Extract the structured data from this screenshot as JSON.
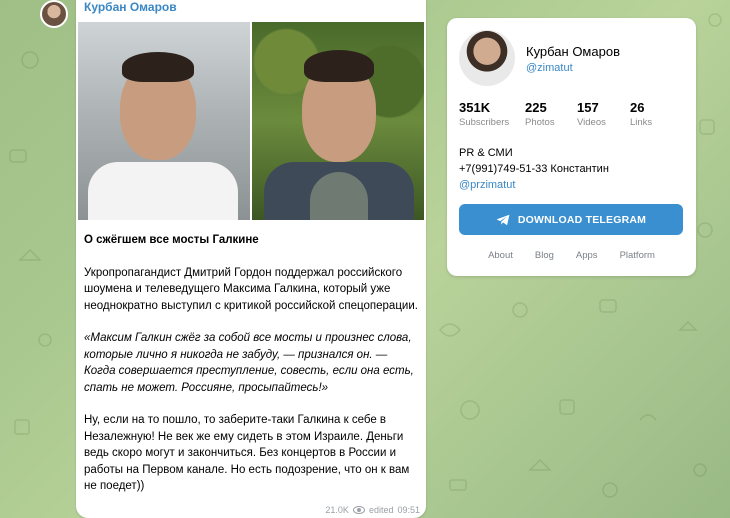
{
  "post": {
    "author": "Курбан Омаров",
    "title": "О сжёгшем все мосты Галкине",
    "paragraph1": "Укропропагандист Дмитрий Гордон поддержал российского шоумена и телеведущего Максима Галкина, который уже неоднократно выступил с критикой российской спецоперации.",
    "quote": "«Максим Галкин сжёг за собой все мосты и произнес слова, которые лично я никогда не забуду, — признался он. — Когда совершается преступление, совесть, если она есть, спать не может. Россияне, просыпайтесь!»",
    "paragraph2": "Ну, если на то пошло, то заберите-таки Галкина к себе в Незалежную! Не век же ему сидеть в этом Израиле. Деньги ведь скоро могут и закончиться. Без концертов в России и работы на Первом канале. Но есть подозрение, что он к вам не поедет))",
    "views": "21.0K",
    "edited": "edited",
    "time": "09:51"
  },
  "channel": {
    "name": "Курбан Омаров",
    "handle": "@zimatut",
    "stats": [
      {
        "value": "351K",
        "label": "Subscribers"
      },
      {
        "value": "225",
        "label": "Photos"
      },
      {
        "value": "157",
        "label": "Videos"
      },
      {
        "value": "26",
        "label": "Links"
      }
    ],
    "description_line1": "PR & СМИ",
    "description_line2": "+7(991)749-51-33 Константин",
    "description_link": "@przimatut",
    "download_label": "DOWNLOAD TELEGRAM",
    "footer_links": [
      "About",
      "Blog",
      "Apps",
      "Platform"
    ]
  },
  "colors": {
    "accent": "#3a87c4",
    "button": "#3a8fd0",
    "background": "#a9c88f"
  }
}
